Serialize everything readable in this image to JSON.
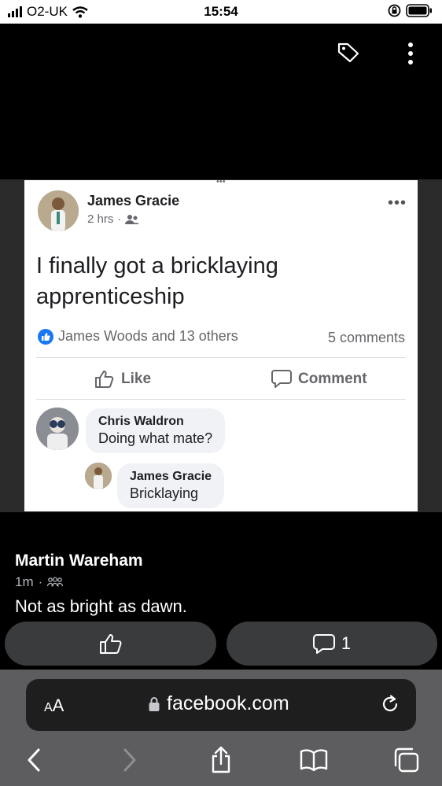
{
  "status_bar": {
    "carrier": "O2-UK",
    "time": "15:54"
  },
  "embedded_post": {
    "author": "James Gracie",
    "time": "2 hrs",
    "separator": "·",
    "text": "I finally got a bricklaying apprenticeship",
    "reactions": "James Woods and 13 others",
    "comments_count": "5 comments",
    "like_label": "Like",
    "comment_label": "Comment",
    "comments": [
      {
        "author": "Chris Waldron",
        "text": "Doing what mate?"
      },
      {
        "author": "James Gracie",
        "text": "Bricklaying"
      }
    ]
  },
  "post": {
    "author": "Martin Wareham",
    "time": "1m",
    "separator": "·",
    "caption": "Not as bright as dawn.",
    "comment_count": "1"
  },
  "safari": {
    "aa_label_big": "A",
    "aa_label_small": "A",
    "url": "facebook.com"
  },
  "colors": {
    "facebook_blue": "#1877f2",
    "pill_bg": "#3a3b3c",
    "safari_toolbar": "#5d5d5f"
  }
}
